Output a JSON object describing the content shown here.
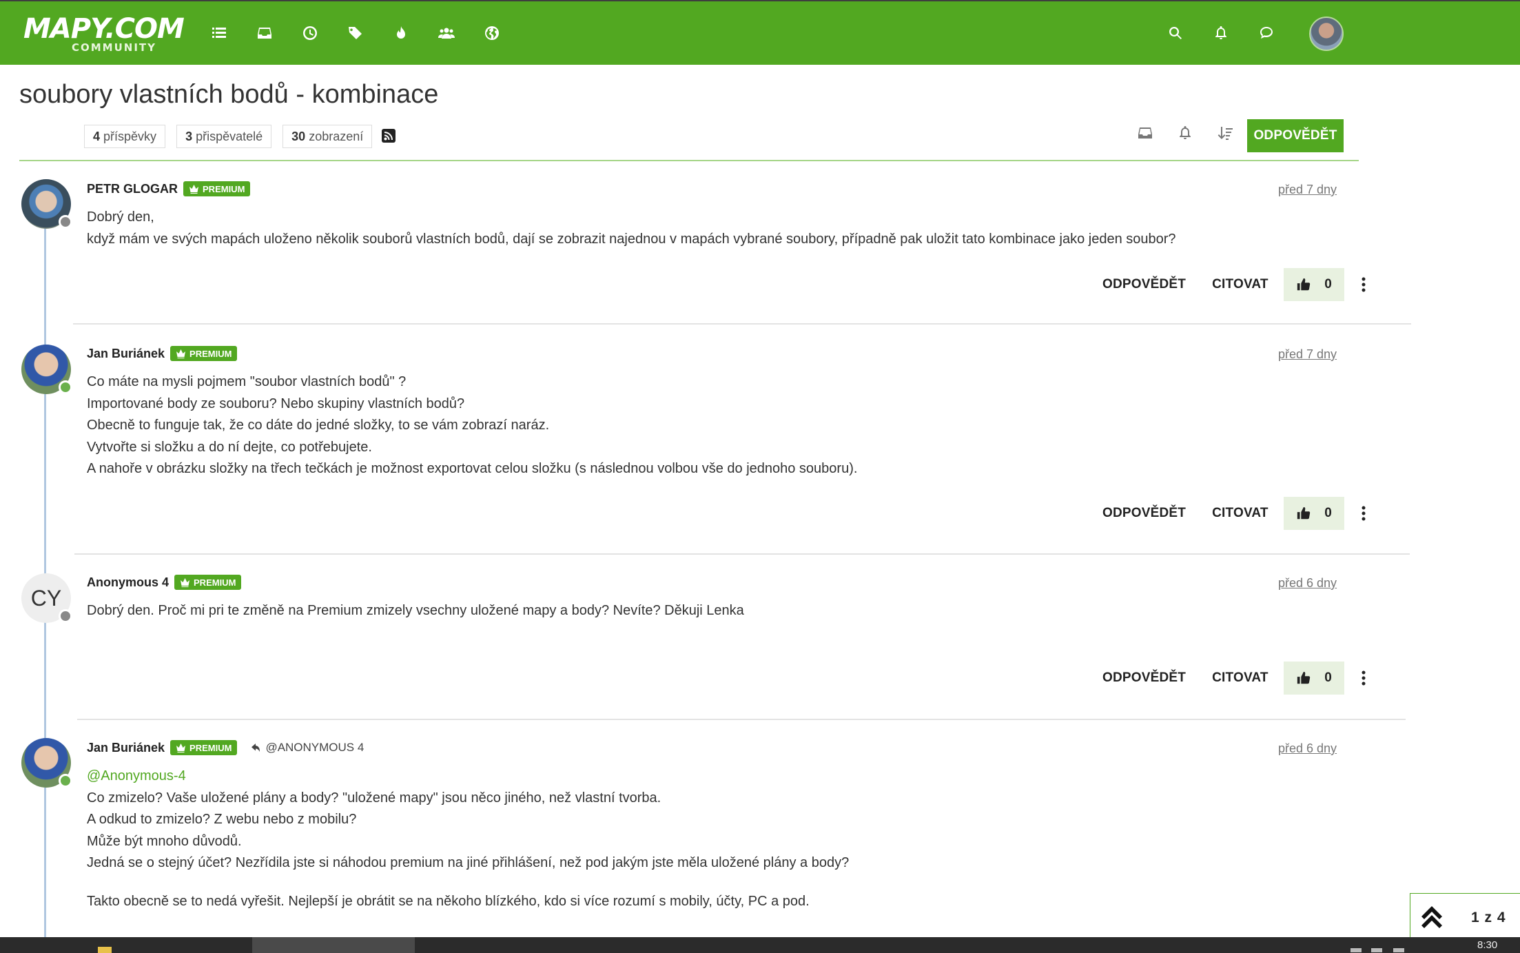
{
  "header": {
    "logo_main": "MAPY.COM",
    "logo_sub": "COMMUNITY",
    "nav_icons": [
      "categories-icon",
      "unread-icon",
      "recent-icon",
      "tags-icon",
      "popular-icon",
      "groups-icon",
      "world-icon"
    ],
    "right_icons": [
      "search-icon",
      "notifications-icon",
      "chat-icon"
    ]
  },
  "topic": {
    "title": "soubory vlastních bodů - kombinace",
    "stats": [
      {
        "count": "4",
        "label": "příspěvky"
      },
      {
        "count": "3",
        "label": "přispěvatelé"
      },
      {
        "count": "30",
        "label": "zobrazení"
      }
    ],
    "reply_button": "ODPOVĚDĚT"
  },
  "actions": {
    "reply": "ODPOVĚDĚT",
    "quote": "CITOVAT"
  },
  "badge_label": "PREMIUM",
  "posts": [
    {
      "author": "PETR GLOGAR",
      "time": "před 7 dny",
      "votes": "0",
      "lines": [
        "Dobrý den,",
        "když mám ve svých mapách uloženo několik souborů vlastních bodů, dají se zobrazit najednou v mapách vybrané soubory, případně pak uložit tato kombinace jako jeden soubor?"
      ]
    },
    {
      "author": "Jan Buriánek",
      "time": "před 7 dny",
      "votes": "0",
      "lines": [
        "Co máte na mysli pojmem \"soubor vlastních bodů\" ?",
        "Importované body ze souboru? Nebo skupiny vlastních bodů?",
        "Obecně to funguje tak, že co dáte do jedné složky, to se vám zobrazí naráz.",
        "Vytvořte si složku a do ní dejte, co potřebujete.",
        "A nahoře v obrázku složky na třech tečkách je možnost exportovat celou složku (s následnou volbou vše do jednoho souboru)."
      ]
    },
    {
      "author": "Anonymous 4",
      "avatar_text": "CY",
      "time": "před 6 dny",
      "votes": "0",
      "lines": [
        "Dobrý den. Proč mi pri te změně na Premium zmizely vsechny uložené mapy a body? Nevíte? Děkuji Lenka"
      ]
    },
    {
      "author": "Jan Buriánek",
      "reply_to": "@ANONYMOUS 4",
      "time": "před 6 dny",
      "mention": "@Anonymous-4",
      "lines": [
        "Co zmizelo? Vaše uložené plány a body? \"uložené mapy\" jsou něco jiného, než vlastní tvorba.",
        "A odkud to zmizelo? Z webu nebo z mobilu?",
        "Může být mnoho důvodů.",
        "Jedná se o stejný účet? Nezřídila jste si náhodou premium na jiné přihlášení, než pod jakým jste měla uložené plány a body?"
      ],
      "lines_after": [
        "Takto obecně se to nedá vyřešit. Nejlepší je obrátit se na někoho blízkého, kdo si více rozumí s mobily, účty, PC a pod."
      ]
    }
  ],
  "pagination": "1 z 4",
  "taskbar": {
    "time": "8:30"
  }
}
